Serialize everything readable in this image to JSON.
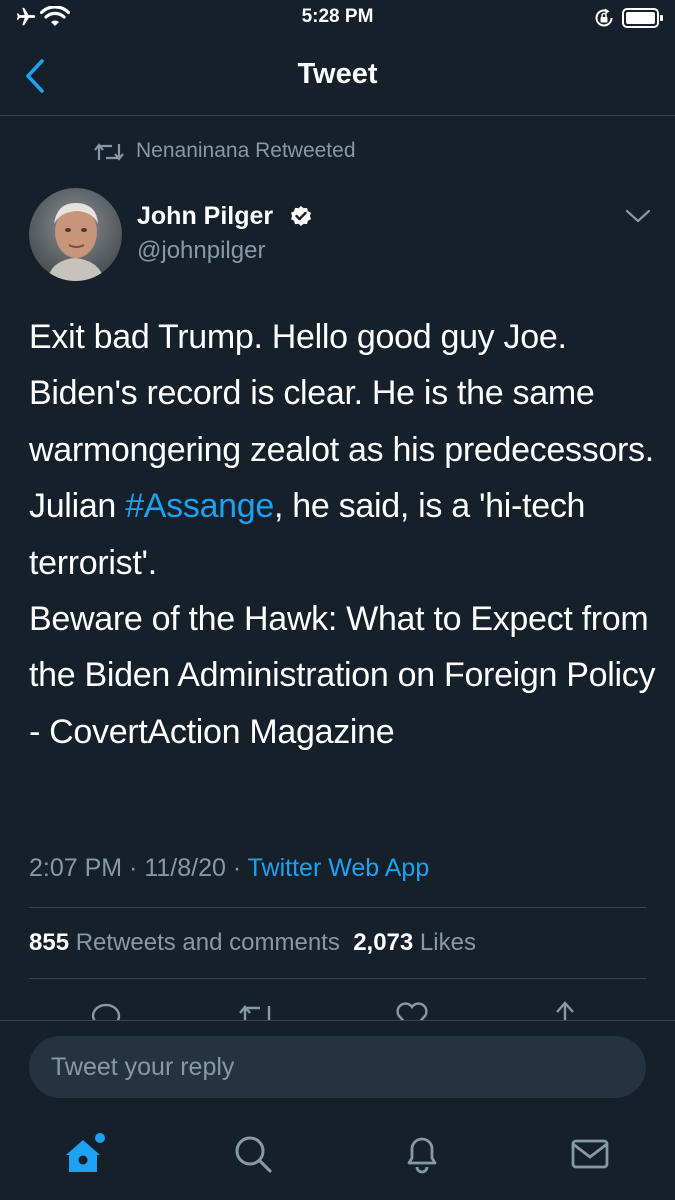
{
  "status_bar": {
    "time": "5:28 PM",
    "icons": [
      "airplane-icon",
      "wifi-icon",
      "rotation-lock-icon",
      "battery-icon"
    ]
  },
  "nav": {
    "title": "Tweet",
    "back_icon": "chevron-left-icon"
  },
  "retweet": {
    "icon": "retweet-icon",
    "text": "Nenaninana Retweeted"
  },
  "author": {
    "name": "John Pilger",
    "handle": "@johnpilger",
    "verified": true
  },
  "tweet": {
    "text_part1": "Exit bad Trump. Hello good guy Joe. Biden's record is clear. He is the same warmongering zealot as his predecessors. Julian ",
    "hashtag": "#Assange",
    "text_part2": ", he said, is a 'hi-tech terrorist'.",
    "text_part3": "Beware of the Hawk: What to Expect from the Biden Administration on Foreign Policy - CovertAction Magazine"
  },
  "meta": {
    "time": "2:07 PM",
    "sep1": " · ",
    "date": "11/8/20",
    "sep2": " · ",
    "source": "Twitter Web App"
  },
  "stats": {
    "retweets_count": "855",
    "retweets_label": "Retweets and comments",
    "likes_count": "2,073",
    "likes_label": "Likes"
  },
  "actions": [
    "reply-icon",
    "retweet-icon",
    "like-icon",
    "share-icon"
  ],
  "reply": {
    "placeholder": "Tweet your reply"
  },
  "tabbar": [
    "home-icon",
    "search-icon",
    "notifications-icon",
    "messages-icon"
  ],
  "colors": {
    "background": "#15202b",
    "accent": "#1da1f2",
    "secondary_text": "#8899a6",
    "divider": "#38444d",
    "input_bg": "#253341"
  }
}
